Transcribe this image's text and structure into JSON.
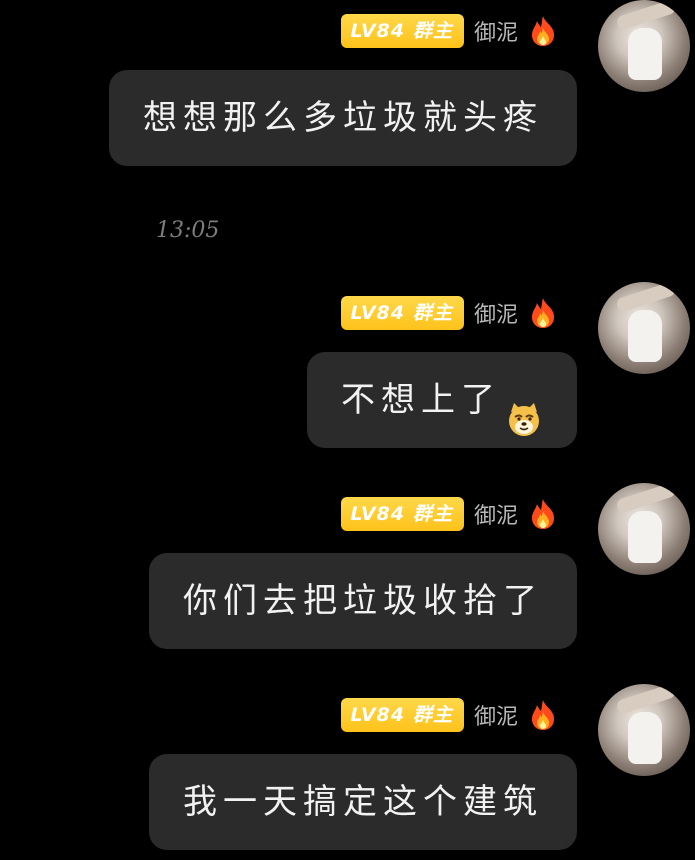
{
  "messages": [
    {
      "badge_level": "LV84",
      "badge_role": "群主",
      "sender": "御泥",
      "text": "想想那么多垃圾就头疼",
      "emoji": ""
    },
    {
      "badge_level": "LV84",
      "badge_role": "群主",
      "sender": "御泥",
      "text": "不想上了",
      "emoji": "doge-face"
    },
    {
      "badge_level": "LV84",
      "badge_role": "群主",
      "sender": "御泥",
      "text": "你们去把垃圾收拾了",
      "emoji": ""
    },
    {
      "badge_level": "LV84",
      "badge_role": "群主",
      "sender": "御泥",
      "text": "我一天搞定这个建筑",
      "emoji": ""
    }
  ],
  "timestamp": "13:05",
  "icons": {
    "flame": "fire-icon",
    "avatar": "avatar"
  },
  "colors": {
    "badge": "#ffc21a",
    "bubble": "#2b2b2b",
    "background": "#000000"
  }
}
